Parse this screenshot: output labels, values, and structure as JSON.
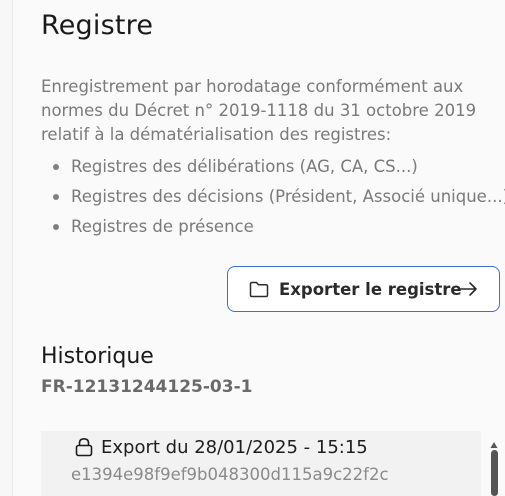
{
  "registre": {
    "title": "Registre",
    "description": "Enregistrement par horodatage conformément aux normes du Décret n° 2019-1118 du 31 octobre 2019 relatif à la dématérialisation des registres:",
    "bullets": [
      "Registres des délibérations (AG, CA, CS...)",
      "Registres des décisions (Président, Associé unique...)",
      "Registres de présence"
    ],
    "export_button_label": "Exporter le registre"
  },
  "historique": {
    "title": "Historique",
    "id": "FR-12131244125-03-1",
    "entries": [
      {
        "title": "Export du 28/01/2025 - 15:15",
        "hash": "e1394e98f9ef9b048300d115a9c22f2c"
      }
    ]
  },
  "icons": {
    "export_button_icon": "folder-icon",
    "export_button_arrow": "arrow-right-icon",
    "entry_icon": "lock-icon"
  },
  "colors": {
    "accent": "#3b6fd4",
    "text_muted": "#7a7a7a"
  }
}
